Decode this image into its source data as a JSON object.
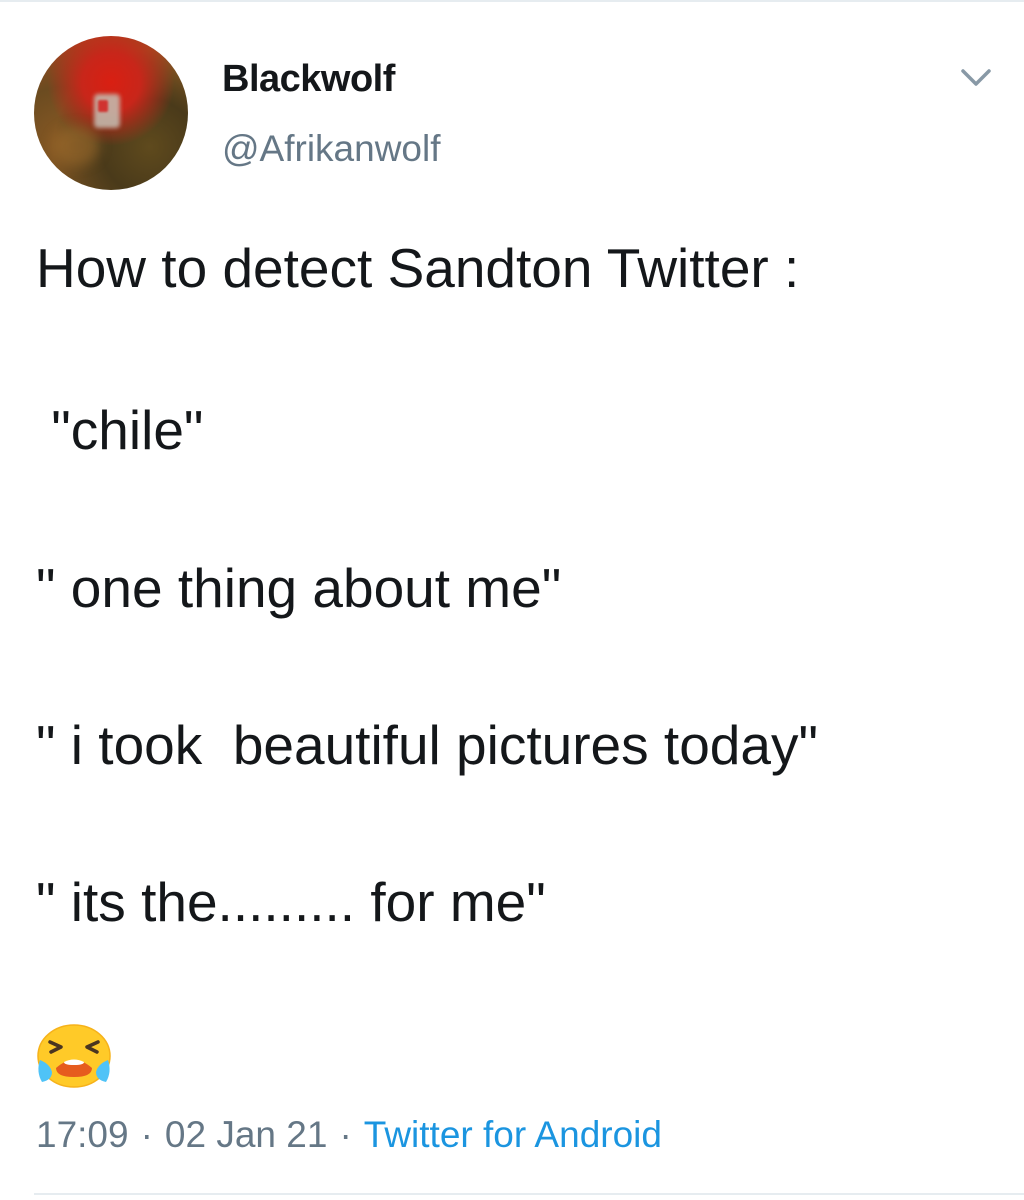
{
  "tweet": {
    "author": {
      "display_name": "Blackwolf",
      "handle": "@Afrikanwolf"
    },
    "menu_icon": "chevron-down-icon",
    "lines": [
      "How to detect Sandton Twitter :",
      " \"chile\"",
      "\" one thing about me\"",
      "\" i took  beautiful pictures today\"",
      "\" its the......... for me\""
    ],
    "emoji": "loudly-crying-face-icon",
    "meta": {
      "time": "17:09",
      "separator": "·",
      "date": "02 Jan 21",
      "source": "Twitter for Android"
    },
    "colors": {
      "text": "#14171a",
      "secondary": "#657786",
      "link": "#1b95e0",
      "divider": "#e6ecf0"
    }
  }
}
